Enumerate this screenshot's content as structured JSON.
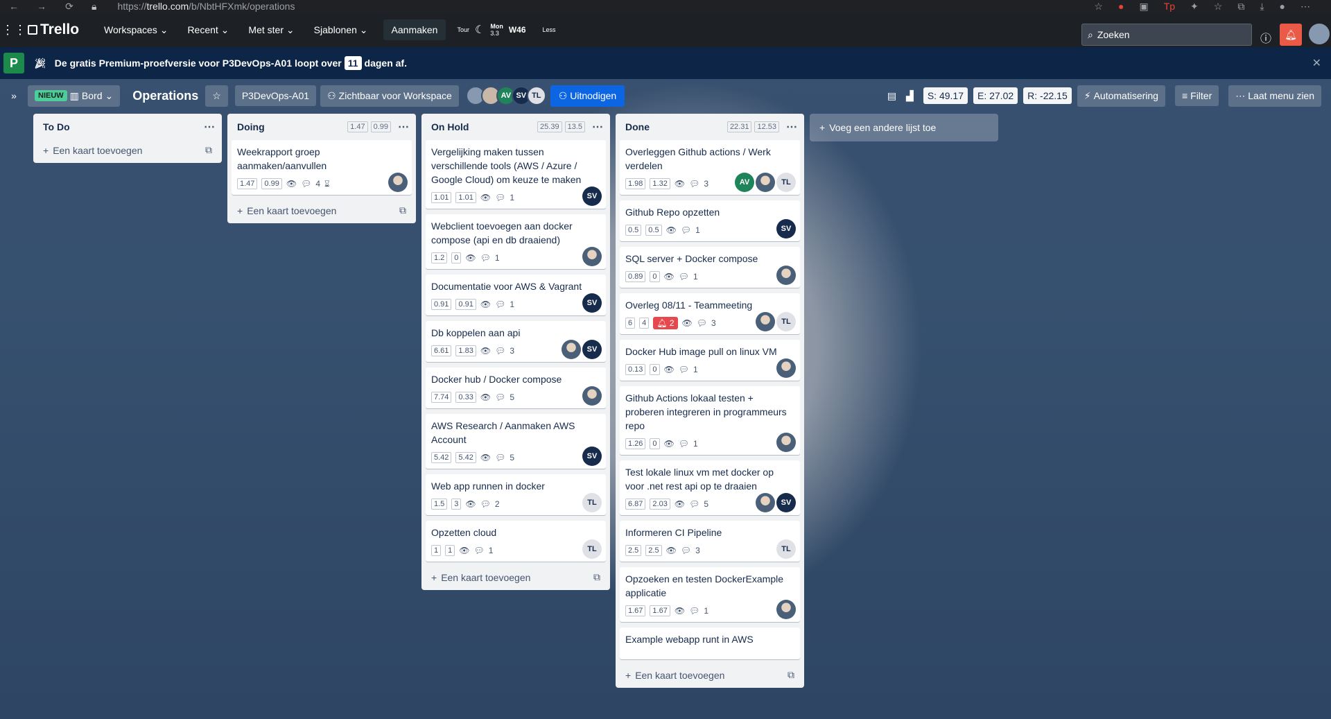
{
  "browser": {
    "url_prefix": "https://",
    "url_host": "trello.com",
    "url_path": "/b/NbtHFXmk/operations"
  },
  "header": {
    "logo": "Trello",
    "menu": [
      "Workspaces",
      "Recent",
      "Met ster",
      "Sjablonen"
    ],
    "create": "Aanmaken",
    "tour": "Tour",
    "weather_day": "Mon",
    "weather_temp": "3.3",
    "week": "W46",
    "less": "Less",
    "search_placeholder": "Zoeken"
  },
  "banner": {
    "badge": "P",
    "text_before": "De gratis Premium-proefversie voor P3DevOps-A01 loopt over",
    "days": "11",
    "text_after": "dagen af."
  },
  "board": {
    "new_tag": "NIEUW",
    "view": "Bord",
    "title": "Operations",
    "workspace": "P3DevOps-A01",
    "visibility": "Zichtbaar voor Workspace",
    "members": [
      "AV",
      "SV",
      "TL"
    ],
    "invite": "Uitnodigen",
    "stat_s": "S: 49.17",
    "stat_e": "E: 27.02",
    "stat_r": "R: -22.15",
    "automation": "Automatisering",
    "filter": "Filter",
    "menu": "Laat menu zien",
    "add_list": "Voeg een andere lijst toe",
    "add_card": "Een kaart toevoegen"
  },
  "lists": [
    {
      "title": "To Do",
      "p1": "",
      "p2": "",
      "cards": []
    },
    {
      "title": "Doing",
      "p1": "1.47",
      "p2": "0.99",
      "cards": [
        {
          "title": "Weekrapport groep aanmaken/aanvullen",
          "a": "1.47",
          "b": "0.99",
          "comments": "4",
          "members": [
            "photo"
          ]
        }
      ]
    },
    {
      "title": "On Hold",
      "p1": "25.39",
      "p2": "13.5",
      "cards": [
        {
          "title": "Vergelijking maken tussen verschillende tools (AWS / Azure / Google Cloud) om keuze te maken",
          "a": "1.01",
          "b": "1.01",
          "comments": "1",
          "members": [
            "SV"
          ]
        },
        {
          "title": "Webclient toevoegen aan docker compose (api en db draaiend)",
          "a": "1.2",
          "b": "0",
          "comments": "1",
          "members": [
            "photo"
          ]
        },
        {
          "title": "Documentatie voor AWS & Vagrant",
          "a": "0.91",
          "b": "0.91",
          "comments": "1",
          "members": [
            "SV"
          ]
        },
        {
          "title": "Db koppelen aan api",
          "a": "6.61",
          "b": "1.83",
          "comments": "3",
          "members": [
            "photo",
            "SV"
          ]
        },
        {
          "title": "Docker hub / Docker compose",
          "a": "7.74",
          "b": "0.33",
          "comments": "5",
          "members": [
            "photo"
          ]
        },
        {
          "title": "AWS Research / Aanmaken AWS Account",
          "a": "5.42",
          "b": "5.42",
          "comments": "5",
          "members": [
            "SV"
          ]
        },
        {
          "title": "Web app runnen in docker",
          "a": "1.5",
          "b": "3",
          "comments": "2",
          "members": [
            "TL"
          ]
        },
        {
          "title": "Opzetten cloud",
          "a": "1",
          "b": "1",
          "comments": "1",
          "members": [
            "TL"
          ]
        }
      ]
    },
    {
      "title": "Done",
      "p1": "22.31",
      "p2": "12.53",
      "cards": [
        {
          "title": "Overleggen Github actions / Werk verdelen",
          "a": "1.98",
          "b": "1.32",
          "comments": "3",
          "members": [
            "AV",
            "photo",
            "TL"
          ]
        },
        {
          "title": "Github Repo opzetten",
          "a": "0.5",
          "b": "0.5",
          "comments": "1",
          "members": [
            "SV"
          ]
        },
        {
          "title": "SQL server + Docker compose",
          "a": "0.89",
          "b": "0",
          "comments": "1",
          "members": [
            "photo"
          ]
        },
        {
          "title": "Overleg 08/11 - Teammeeting",
          "a": "6",
          "b": "4",
          "alert": "2",
          "comments": "3",
          "members": [
            "photo",
            "TL"
          ]
        },
        {
          "title": "Docker Hub image pull on linux VM",
          "a": "0.13",
          "b": "0",
          "comments": "1",
          "members": [
            "photo"
          ]
        },
        {
          "title": "Github Actions lokaal testen + proberen integreren in programmeurs repo",
          "a": "1.26",
          "b": "0",
          "comments": "1",
          "members": [
            "photo"
          ]
        },
        {
          "title": "Test lokale linux vm met docker op voor .net rest api op te draaien",
          "a": "6.87",
          "b": "2.03",
          "comments": "5",
          "members": [
            "photo",
            "SV"
          ]
        },
        {
          "title": "Informeren CI Pipeline",
          "a": "2.5",
          "b": "2.5",
          "comments": "3",
          "members": [
            "TL"
          ]
        },
        {
          "title": "Opzoeken en testen DockerExample applicatie",
          "a": "1.67",
          "b": "1.67",
          "comments": "1",
          "members": [
            "photo"
          ]
        },
        {
          "title": "Example webapp runt in AWS",
          "a": "",
          "b": "",
          "comments": "",
          "members": []
        }
      ]
    }
  ]
}
